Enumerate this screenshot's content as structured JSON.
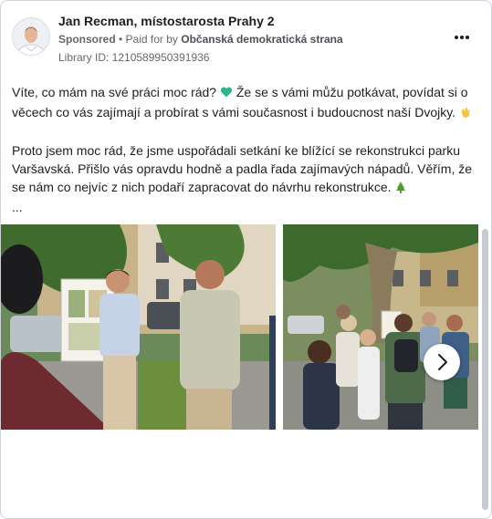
{
  "post": {
    "author": "Jan Recman, místostarosta Prahy 2",
    "sponsored": "Sponsored",
    "separator": " • ",
    "paid_prefix": "Paid for by ",
    "payer": "Občanská demokratická strana",
    "library_id": "Library ID: 1210589950391936",
    "more_icon": "more-horizontal-icon",
    "paragraph1_a": "Víte, co mám na své práci moc rád? ",
    "paragraph1_b": " Že se s vámi můžu potkávat, povídat si o věcech co vás zajímají a probírat s vámi současnost i budoucnost naší Dvojky. ",
    "paragraph2": "Proto jsem moc rád, že jsme uspořádali setkání ke blížící se rekonstrukci parku Varšavská. Přišlo vás opravdu hodně a padla řada zajímavých nápadů. Věřím, že se nám co nejvíc z nich podaří zapracovat do návrhu rekonstrukce. ",
    "see_more": "..."
  },
  "carousel": {
    "images": [
      "park-meeting-photo-1",
      "park-meeting-photo-2"
    ],
    "next_icon": "chevron-right-icon"
  },
  "colors": {
    "heart": "#2fb58a",
    "hand": "#f3c53e",
    "tree": "#5aa83a",
    "text": "#1c1e21",
    "secondary": "#65676b"
  }
}
